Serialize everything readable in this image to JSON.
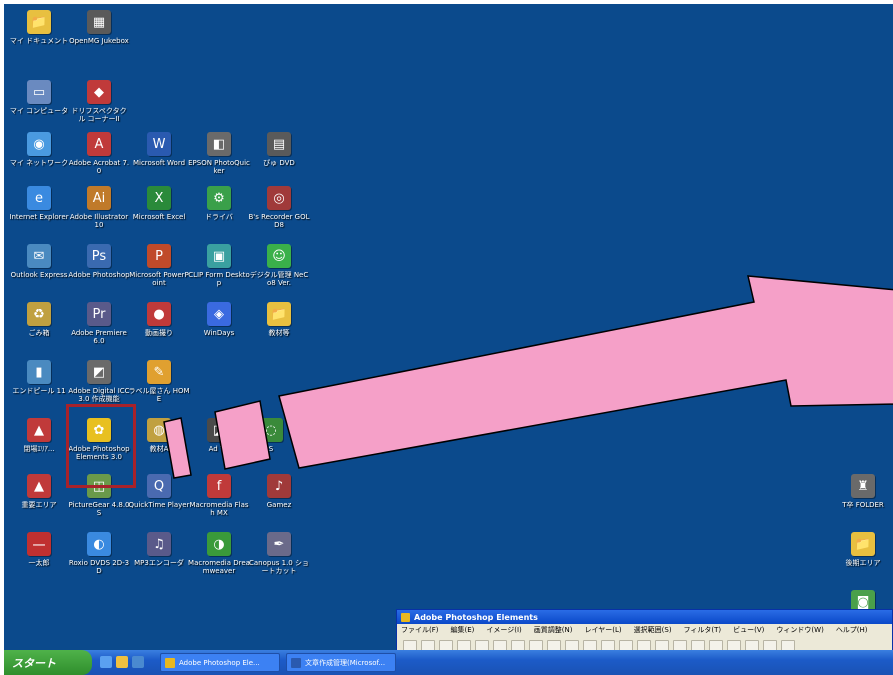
{
  "desktop": {
    "background": "#0b4a8c",
    "icons": [
      {
        "label": "マイ ドキュメント",
        "color": "#e8c040",
        "glyph": "📁"
      },
      {
        "label": "OpenMG Jukebox",
        "color": "#5a5a5a",
        "glyph": "▦"
      },
      {
        "label": "マイ コンピュータ",
        "color": "#6a8ac0",
        "glyph": "▭"
      },
      {
        "label": "ドリフスペクタクル コーナーII",
        "color": "#c03a3a",
        "glyph": "◆"
      },
      {
        "label": "マイ ネットワーク",
        "color": "#4a9ae0",
        "glyph": "◉"
      },
      {
        "label": "Adobe Acrobat 7.0",
        "color": "#c03a3a",
        "glyph": "A"
      },
      {
        "label": "Microsoft Word",
        "color": "#2a5ab0",
        "glyph": "W"
      },
      {
        "label": "EPSON PhotoQuicker",
        "color": "#6a6a6a",
        "glyph": "◧"
      },
      {
        "label": "ぴゅ DVD",
        "color": "#5a5a5a",
        "glyph": "▤"
      },
      {
        "label": "Internet Explorer",
        "color": "#3a8ae0",
        "glyph": "e"
      },
      {
        "label": "Adobe Illustrator 10",
        "color": "#c07a2a",
        "glyph": "Ai"
      },
      {
        "label": "Microsoft Excel",
        "color": "#2a8a3a",
        "glyph": "X"
      },
      {
        "label": "ドライバ",
        "color": "#3aa04a",
        "glyph": "⚙"
      },
      {
        "label": "B's Recorder GOLD8",
        "color": "#a03a3a",
        "glyph": "◎"
      },
      {
        "label": "Outlook Express",
        "color": "#4a8ac0",
        "glyph": "✉"
      },
      {
        "label": "Adobe Photoshop",
        "color": "#3a6ab0",
        "glyph": "Ps"
      },
      {
        "label": "Microsoft PowerPoint",
        "color": "#c04a2a",
        "glyph": "P"
      },
      {
        "label": "CLIP Form Desktop",
        "color": "#3aa0a0",
        "glyph": "▣"
      },
      {
        "label": "デジタル管理 NeCo8 Ver.",
        "color": "#3ab04a",
        "glyph": "☺"
      },
      {
        "label": "ごみ箱",
        "color": "#c0a040",
        "glyph": "♻"
      },
      {
        "label": "Adobe Premiere 6.0",
        "color": "#5a5a8a",
        "glyph": "Pr"
      },
      {
        "label": "動画撮り",
        "color": "#c03a3a",
        "glyph": "●"
      },
      {
        "label": "WinDays",
        "color": "#3a6ae0",
        "glyph": "◈"
      },
      {
        "label": "教材等",
        "color": "#e8c040",
        "glyph": "📁"
      },
      {
        "label": "エンドピール 11",
        "color": "#4a8ac0",
        "glyph": "▮"
      },
      {
        "label": "Adobe Digital ICC 3.0 作成機能",
        "color": "#6a6a6a",
        "glyph": "◩"
      },
      {
        "label": "ラベル屋さん HOME",
        "color": "#e0a030",
        "glyph": "✎"
      },
      {
        "label": "閉場ｴﾘｱ...",
        "color": "#c03a3a",
        "glyph": "▲"
      },
      {
        "label": "Adobe Photoshop Elements 3.0",
        "color": "#e8c020",
        "glyph": "✿"
      },
      {
        "label": "教材A",
        "color": "#c0a040",
        "glyph": "◍"
      },
      {
        "label": "Ad Wr",
        "color": "#4a4a4a",
        "glyph": "◪"
      },
      {
        "label": "S",
        "color": "#3a8a3a",
        "glyph": "◌"
      },
      {
        "label": "重要エリア",
        "color": "#c03a3a",
        "glyph": "▲"
      },
      {
        "label": "PictureGear 4.8.0S",
        "color": "#6a9a4a",
        "glyph": "◫"
      },
      {
        "label": "QuickTime Player",
        "color": "#4a6ab0",
        "glyph": "Q"
      },
      {
        "label": "Macromedia Flash MX",
        "color": "#c03a3a",
        "glyph": "f"
      },
      {
        "label": "Gamez",
        "color": "#a03a3a",
        "glyph": "♪"
      },
      {
        "label": "一太郎",
        "color": "#c03030",
        "glyph": "一"
      },
      {
        "label": "Roxio DVDS 2D-3D",
        "color": "#3a8ae0",
        "glyph": "◐"
      },
      {
        "label": "MP3エンコーダ",
        "color": "#5a5a8a",
        "glyph": "♫"
      },
      {
        "label": "Macromedia Dreamweaver",
        "color": "#3a9a3a",
        "glyph": "◑"
      },
      {
        "label": "Canopus 1.0 ショートカット",
        "color": "#6a6a8a",
        "glyph": "✒"
      },
      {
        "label": "T卒 FOLDER",
        "color": "#e8a030",
        "glyph": "▶"
      },
      {
        "label": "T卒 FOLDER",
        "color": "#6a6a6a",
        "glyph": "♜"
      },
      {
        "label": "後期エリア",
        "color": "#e8c040",
        "glyph": "📁"
      },
      {
        "label": "",
        "color": "#4aa04a",
        "glyph": "◙"
      }
    ]
  },
  "arrow": {
    "color": "#f5a0c8",
    "stroke": "#000000"
  },
  "highlight_color": "#a8222a",
  "taskbar": {
    "start_label": "スタート",
    "tasks": [
      {
        "label": "Adobe Photoshop Ele...",
        "icon_color": "#e8b820"
      },
      {
        "label": "文章作成管理(Microsof...",
        "icon_color": "#2a5ab0"
      }
    ]
  },
  "pse_window": {
    "title": "Adobe Photoshop Elements",
    "menu": [
      "ファイル(F)",
      "編集(E)",
      "イメージ(I)",
      "画質調整(N)",
      "レイヤー(L)",
      "選択範囲(S)",
      "フィルタ(T)",
      "ビュー(V)",
      "ウィンドウ(W)",
      "ヘルプ(H)"
    ]
  }
}
